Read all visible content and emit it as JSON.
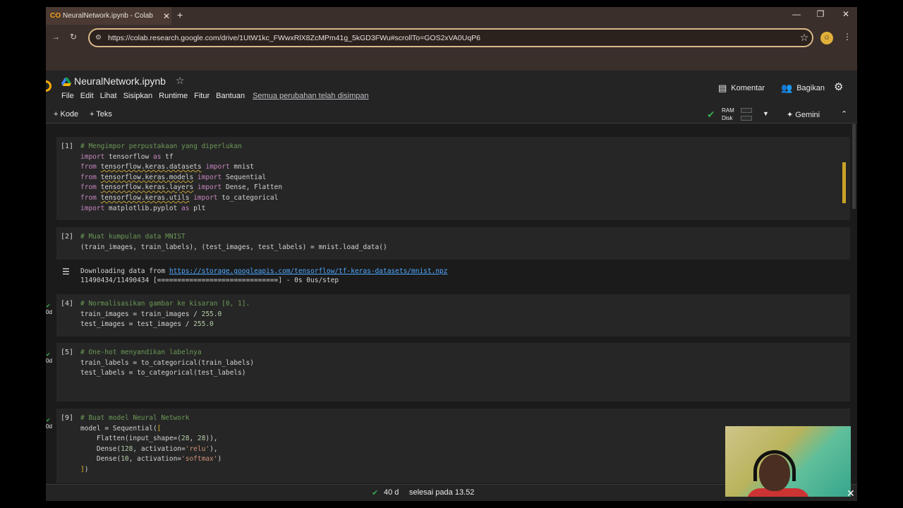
{
  "browser": {
    "tab_title": "NeuralNetwork.ipynb - Colab",
    "url": "https://colab.research.google.com/drive/1UtW1kc_FWwxRlX8ZcMPm41g_5kGD3FWu#scrollTo=GOS2xVA0UqP6"
  },
  "header": {
    "filename": "NeuralNetwork.ipynb",
    "menu": [
      "File",
      "Edit",
      "Lihat",
      "Sisipkan",
      "Runtime",
      "Fitur",
      "Bantuan"
    ],
    "saved_status": "Semua perubahan telah disimpan",
    "comment_label": "Komentar",
    "share_label": "Bagikan"
  },
  "cellbar": {
    "add_code": "+ Kode",
    "add_text": "+ Teks",
    "ram_label": "RAM",
    "disk_label": "Disk",
    "gemini_label": "Gemini"
  },
  "cells": [
    {
      "prompt": "[1]",
      "lines": [
        "# Mengimpor perpustakaan yang diperlukan",
        "import tensorflow as tf",
        "from tensorflow.keras.datasets import mnist",
        "from tensorflow.keras.models import Sequential",
        "from tensorflow.keras.layers import Dense, Flatten",
        "from tensorflow.keras.utils import to_categorical",
        "import matplotlib.pyplot as plt"
      ]
    },
    {
      "prompt": "[2]",
      "lines": [
        "# Muat kumpulan data MNIST",
        "(train_images, train_labels), (test_images, test_labels) = mnist.load_data()"
      ],
      "output": [
        "Downloading data from https://storage.googleapis.com/tensorflow/tf-keras-datasets/mnist.npz",
        "11490434/11490434 [==============================] - 0s 0us/step"
      ],
      "output_link": "https://storage.googleapis.com/tensorflow/tf-keras-datasets/mnist.npz"
    },
    {
      "prompt": "[4]",
      "run_time": "0d",
      "lines": [
        "# Normalisasikan gambar ke kisaran [0, 1].",
        "train_images = train_images / 255.0",
        "test_images = test_images / 255.0"
      ]
    },
    {
      "prompt": "[5]",
      "run_time": "0d",
      "lines": [
        "# One-hot menyandikan labelnya",
        "train_labels = to_categorical(train_labels)",
        "test_labels = to_categorical(test_labels)"
      ]
    },
    {
      "prompt": "[9]",
      "run_time": "0d",
      "lines": [
        "# Buat model Neural Network",
        "model = Sequential([",
        "    Flatten(input_shape=(28, 28)),",
        "    Dense(128, activation='relu'),",
        "    Dense(10, activation='softmax')",
        "])"
      ]
    }
  ],
  "statusbar": {
    "elapsed": "40 d",
    "finished": "selesai pada 13.52"
  },
  "colors": {
    "accent_green": "#34a853",
    "link": "#4fa8ff",
    "comment": "#6a9955",
    "keyword": "#c586c0"
  }
}
